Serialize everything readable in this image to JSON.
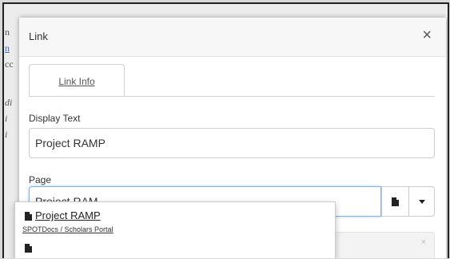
{
  "dialog": {
    "title": "Link",
    "close_glyph": "×"
  },
  "tabs": [
    {
      "label": "Link Info",
      "active": true
    }
  ],
  "display_text": {
    "label": "Display Text",
    "value": "Project RAMP"
  },
  "page": {
    "label": "Page",
    "value": "Project RAM",
    "addon_icons": [
      "document-icon",
      "caret-down-icon"
    ]
  },
  "hint": {
    "close_glyph": "×"
  },
  "suggestions": [
    {
      "title": "Project RAMP",
      "path": "SPOTDocs / Scholars Portal",
      "icon": "document-icon"
    },
    {
      "title": "",
      "path": "",
      "icon": "document-icon"
    }
  ],
  "background_fragments": [
    "n",
    "n",
    "cc",
    "ir",
    "di",
    "i",
    "i",
    "i"
  ],
  "colors": {
    "focus_border": "#7fb2e6",
    "header_bg": "#f7f7f7"
  }
}
